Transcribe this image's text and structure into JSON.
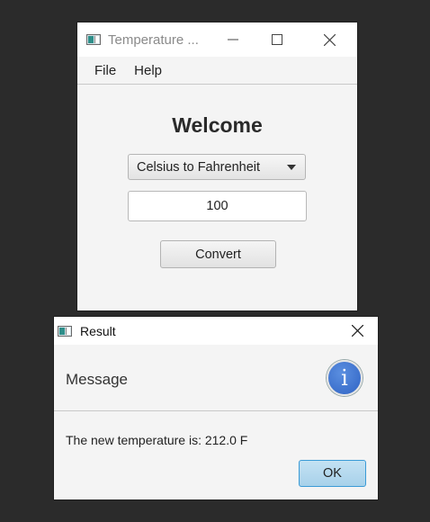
{
  "main_window": {
    "title": "Temperature ...",
    "menus": [
      "File",
      "Help"
    ],
    "heading": "Welcome",
    "conversion_select": {
      "selected": "Celsius to Fahrenheit"
    },
    "temperature_input": {
      "value": "100"
    },
    "convert_label": "Convert"
  },
  "dialog": {
    "title": "Result",
    "header": "Message",
    "info_icon_glyph": "i",
    "content": "The new temperature is: 212.0 F",
    "ok_label": "OK"
  },
  "icons": {
    "minimize": "minimize-icon",
    "maximize": "maximize-icon",
    "close": "close-icon",
    "info": "info-icon",
    "dropdown": "chevron-down-icon"
  },
  "colors": {
    "desktop": "#2b2b2b",
    "window_bg": "#f4f4f4",
    "info_blue": "#2f63c4",
    "ok_button": "#a7d1ea"
  }
}
